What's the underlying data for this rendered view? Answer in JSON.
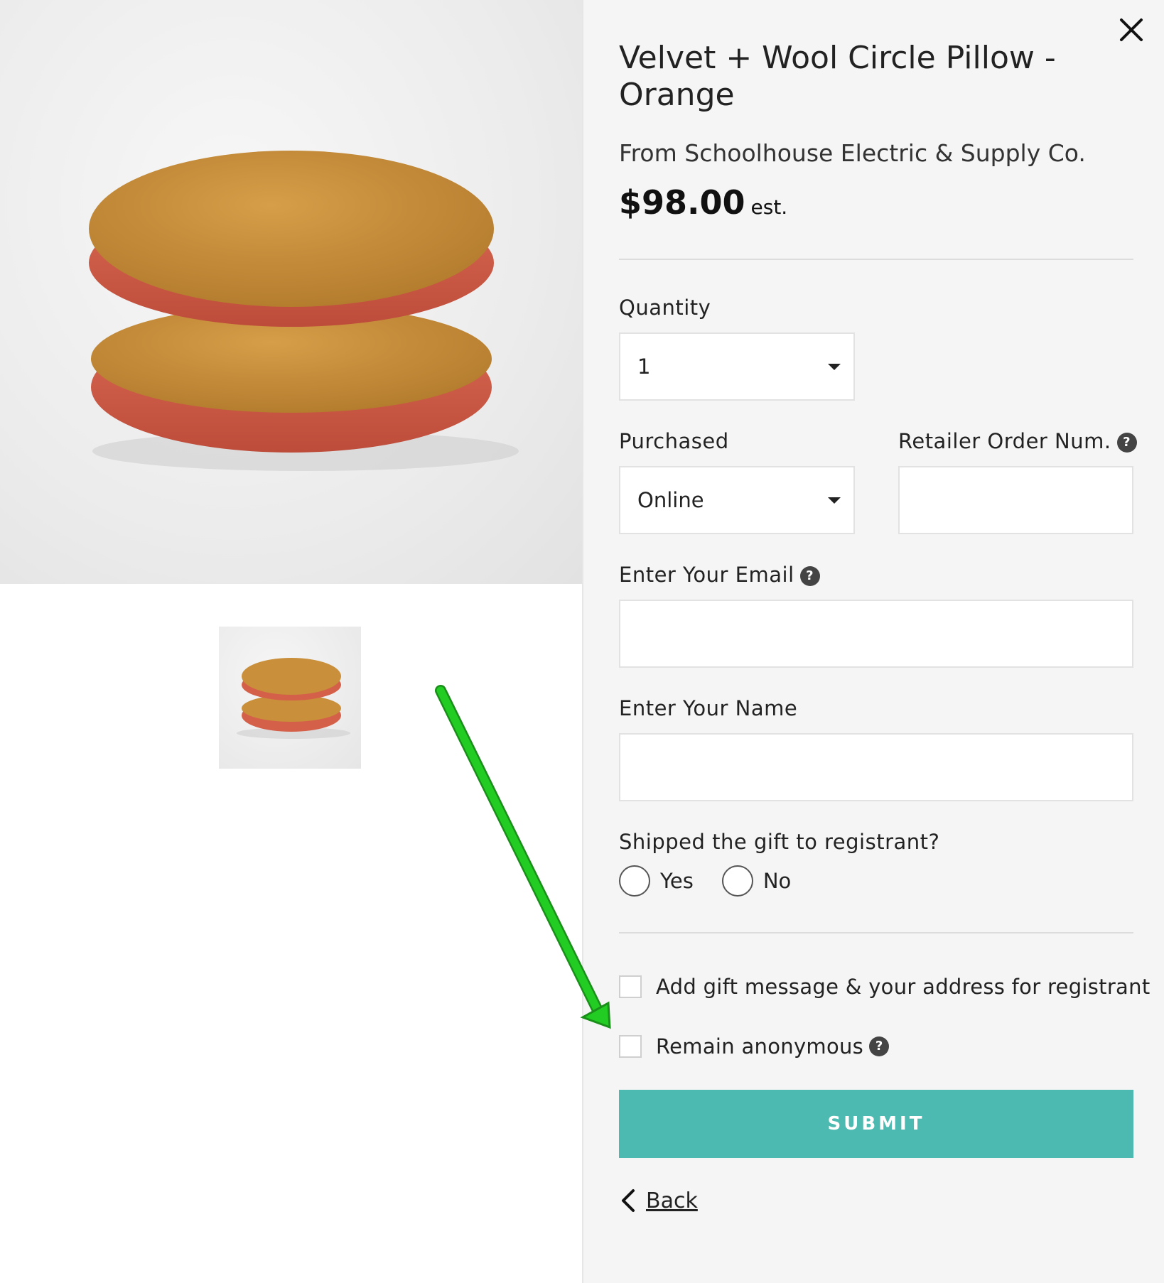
{
  "product": {
    "title": "Velvet + Wool Circle Pillow - Orange",
    "retailer": "From Schoolhouse Electric & Supply Co.",
    "price": "$98.00",
    "price_suffix": "est."
  },
  "form": {
    "quantity_label": "Quantity",
    "quantity_value": "1",
    "purchased_label": "Purchased",
    "purchased_value": "Online",
    "order_num_label": "Retailer Order Num.",
    "order_num_value": "",
    "email_label": "Enter Your Email",
    "email_value": "",
    "name_label": "Enter Your Name",
    "name_value": "",
    "shipped_label": "Shipped the gift to registrant?",
    "shipped_yes": "Yes",
    "shipped_no": "No",
    "gift_message_label": "Add gift message & your address for registrant",
    "anonymous_label": "Remain anonymous",
    "help_glyph": "?"
  },
  "actions": {
    "submit_label": "SUBMIT",
    "back_label": "Back"
  },
  "colors": {
    "submit_bg": "#4cbab0",
    "annotation_arrow": "#22cc22",
    "pillow_top": "#c98f3a",
    "pillow_bottom": "#d4604a"
  },
  "icons": {
    "close": "close-icon",
    "back": "chevron-left-icon",
    "help": "help-icon",
    "dropdown": "caret-down-icon"
  }
}
